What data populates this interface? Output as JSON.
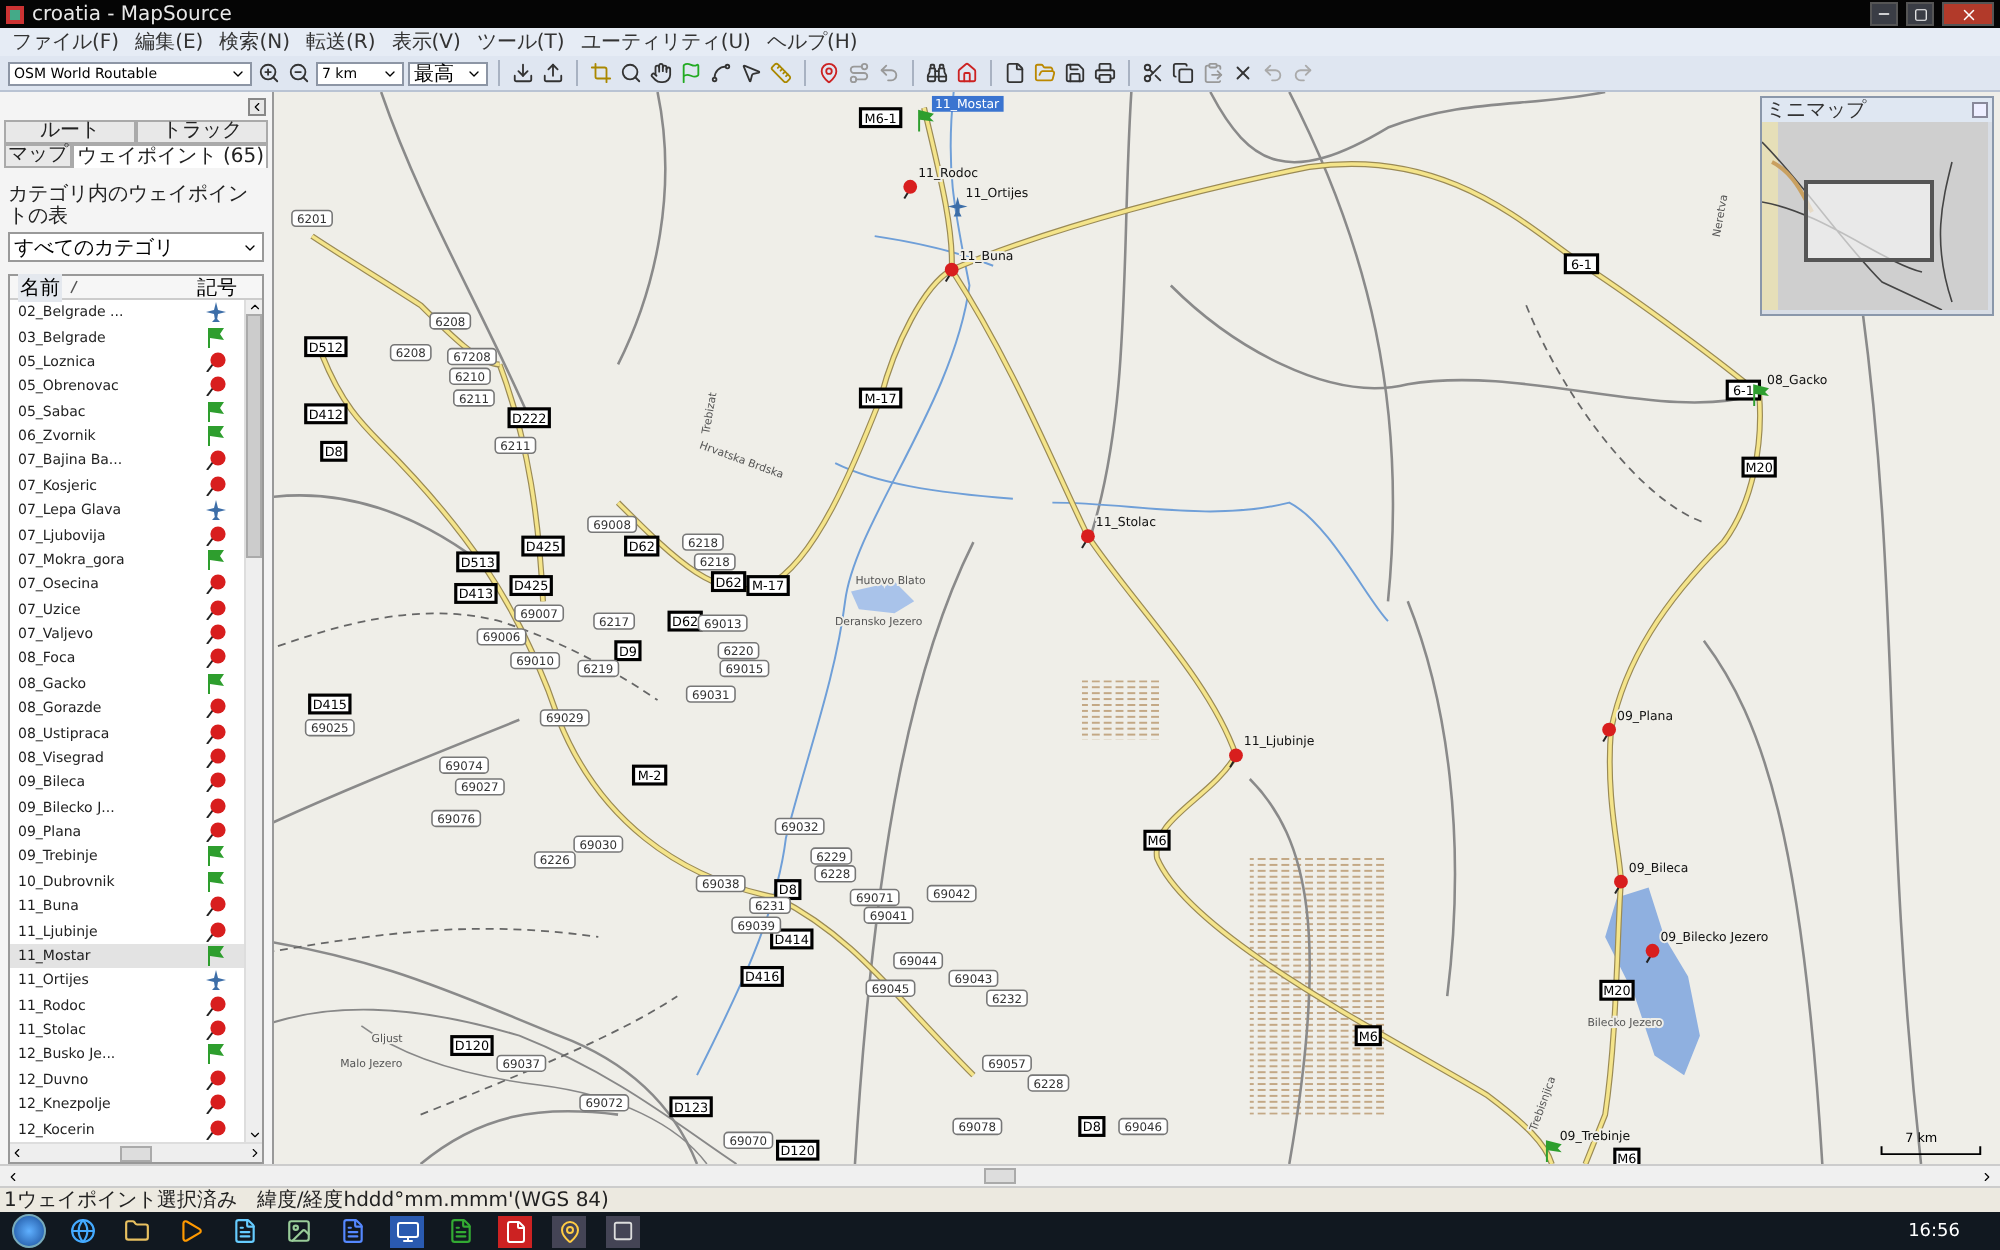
{
  "window": {
    "title": "croatia - MapSource"
  },
  "menu": [
    "ファイル(F)",
    "編集(E)",
    "検索(N)",
    "転送(R)",
    "表示(V)",
    "ツール(T)",
    "ユーティリティ(U)",
    "ヘルプ(H)"
  ],
  "toolbar": {
    "map_product": "OSM World Routable",
    "zoom_scale": "7 km",
    "detail": "最高"
  },
  "sidebar": {
    "tabs_top": [
      {
        "label": "ルート",
        "selected": false
      },
      {
        "label": "トラック",
        "selected": false
      }
    ],
    "tabs_bottom": [
      {
        "label": "マップ",
        "selected": false
      },
      {
        "label": "ウェイポイント (65)",
        "selected": true
      }
    ],
    "category_label": "カテゴリ内のウェイポイントの表",
    "category": "すべてのカテゴリ",
    "columns": [
      {
        "label": "名前",
        "sorted": true
      },
      {
        "label": "記号",
        "sorted": false
      }
    ],
    "waypoints": [
      {
        "name": "02_Belgrade ...",
        "kind": "plane",
        "selected": false
      },
      {
        "name": "03_Belgrade",
        "kind": "flag",
        "selected": false
      },
      {
        "name": "05_Loznica",
        "kind": "pin",
        "selected": false
      },
      {
        "name": "05_Obrenovac",
        "kind": "pin",
        "selected": false
      },
      {
        "name": "05_Sabac",
        "kind": "flag",
        "selected": false
      },
      {
        "name": "06_Zvornik",
        "kind": "flag",
        "selected": false
      },
      {
        "name": "07_Bajina Ba...",
        "kind": "pin",
        "selected": false
      },
      {
        "name": "07_Kosjeric",
        "kind": "pin",
        "selected": false
      },
      {
        "name": "07_Lepa Glava",
        "kind": "plane",
        "selected": false
      },
      {
        "name": "07_Ljubovija",
        "kind": "pin",
        "selected": false
      },
      {
        "name": "07_Mokra_gora",
        "kind": "flag",
        "selected": false
      },
      {
        "name": "07_Osecina",
        "kind": "pin",
        "selected": false
      },
      {
        "name": "07_Uzice",
        "kind": "pin",
        "selected": false
      },
      {
        "name": "07_Valjevo",
        "kind": "pin",
        "selected": false
      },
      {
        "name": "08_Foca",
        "kind": "pin",
        "selected": false
      },
      {
        "name": "08_Gacko",
        "kind": "flag",
        "selected": false
      },
      {
        "name": "08_Gorazde",
        "kind": "pin",
        "selected": false
      },
      {
        "name": "08_Ustipraca",
        "kind": "pin",
        "selected": false
      },
      {
        "name": "08_Visegrad",
        "kind": "pin",
        "selected": false
      },
      {
        "name": "09_Bileca",
        "kind": "pin",
        "selected": false
      },
      {
        "name": "09_Bilecko J...",
        "kind": "pin",
        "selected": false
      },
      {
        "name": "09_Plana",
        "kind": "pin",
        "selected": false
      },
      {
        "name": "09_Trebinje",
        "kind": "flag",
        "selected": false
      },
      {
        "name": "10_Dubrovnik",
        "kind": "flag",
        "selected": false
      },
      {
        "name": "11_Buna",
        "kind": "pin",
        "selected": false
      },
      {
        "name": "11_Ljubinje",
        "kind": "pin",
        "selected": false
      },
      {
        "name": "11_Mostar",
        "kind": "flag",
        "selected": true
      },
      {
        "name": "11_Ortijes",
        "kind": "plane",
        "selected": false
      },
      {
        "name": "11_Rodoc",
        "kind": "pin",
        "selected": false
      },
      {
        "name": "11_Stolac",
        "kind": "pin",
        "selected": false
      },
      {
        "name": "12_Busko Je...",
        "kind": "flag",
        "selected": false
      },
      {
        "name": "12_Duvno",
        "kind": "pin",
        "selected": false
      },
      {
        "name": "12_Knezpolje",
        "kind": "pin",
        "selected": false
      },
      {
        "name": "12_Kocerin",
        "kind": "pin",
        "selected": false
      }
    ]
  },
  "map": {
    "waypoints": [
      {
        "name": "11_Mostar",
        "kind": "flag",
        "selected": true
      },
      {
        "name": "11_Rodoc",
        "kind": "pin",
        "selected": false
      },
      {
        "name": "11_Ortijes",
        "kind": "plane",
        "selected": false
      },
      {
        "name": "11_Buna",
        "kind": "pin",
        "selected": false
      },
      {
        "name": "11_Stolac",
        "kind": "pin",
        "selected": false
      },
      {
        "name": "11_Ljubinje",
        "kind": "pin",
        "selected": false
      },
      {
        "name": "09_Plana",
        "kind": "pin",
        "selected": false
      },
      {
        "name": "09_Bileca",
        "kind": "pin",
        "selected": false
      },
      {
        "name": "09_Bilecko Jezero",
        "kind": "pin",
        "selected": false
      },
      {
        "name": "08_Gacko",
        "kind": "flag",
        "selected": false
      },
      {
        "name": "09_Trebinje",
        "kind": "flag",
        "selected": false
      }
    ],
    "road_labels": [
      {
        "text": "M6-1",
        "kind": "highway"
      },
      {
        "text": "6-1",
        "kind": "highway"
      },
      {
        "text": "6-1",
        "kind": "highway"
      },
      {
        "text": "M-17",
        "kind": "highway"
      },
      {
        "text": "M-17",
        "kind": "highway"
      },
      {
        "text": "D512",
        "kind": "highway"
      },
      {
        "text": "D412",
        "kind": "highway"
      },
      {
        "text": "D8",
        "kind": "highway"
      },
      {
        "text": "D222",
        "kind": "highway"
      },
      {
        "text": "D425",
        "kind": "highway"
      },
      {
        "text": "D513",
        "kind": "highway"
      },
      {
        "text": "D413",
        "kind": "highway"
      },
      {
        "text": "D425",
        "kind": "highway"
      },
      {
        "text": "D62",
        "kind": "highway"
      },
      {
        "text": "D62",
        "kind": "highway"
      },
      {
        "text": "D9",
        "kind": "highway"
      },
      {
        "text": "D62",
        "kind": "highway"
      },
      {
        "text": "D415",
        "kind": "highway"
      },
      {
        "text": "M-2",
        "kind": "highway"
      },
      {
        "text": "M6",
        "kind": "highway"
      },
      {
        "text": "M20",
        "kind": "highway"
      },
      {
        "text": "M20",
        "kind": "highway"
      },
      {
        "text": "M6",
        "kind": "highway"
      },
      {
        "text": "D8",
        "kind": "highway"
      },
      {
        "text": "D414",
        "kind": "highway"
      },
      {
        "text": "D416",
        "kind": "highway"
      },
      {
        "text": "D120",
        "kind": "highway"
      },
      {
        "text": "D123",
        "kind": "highway"
      },
      {
        "text": "D120",
        "kind": "highway"
      },
      {
        "text": "D8",
        "kind": "highway"
      },
      {
        "text": "M6",
        "kind": "highway"
      },
      {
        "text": "6201",
        "kind": "local"
      },
      {
        "text": "6208",
        "kind": "local"
      },
      {
        "text": "6208",
        "kind": "local"
      },
      {
        "text": "67208",
        "kind": "local"
      },
      {
        "text": "6210",
        "kind": "local"
      },
      {
        "text": "6211",
        "kind": "local"
      },
      {
        "text": "6211",
        "kind": "local"
      },
      {
        "text": "69008",
        "kind": "local"
      },
      {
        "text": "6218",
        "kind": "local"
      },
      {
        "text": "6218",
        "kind": "local"
      },
      {
        "text": "6217",
        "kind": "local"
      },
      {
        "text": "69013",
        "kind": "local"
      },
      {
        "text": "69007",
        "kind": "local"
      },
      {
        "text": "69010",
        "kind": "local"
      },
      {
        "text": "69006",
        "kind": "local"
      },
      {
        "text": "6219",
        "kind": "local"
      },
      {
        "text": "6220",
        "kind": "local"
      },
      {
        "text": "69015",
        "kind": "local"
      },
      {
        "text": "69031",
        "kind": "local"
      },
      {
        "text": "69029",
        "kind": "local"
      },
      {
        "text": "69025",
        "kind": "local"
      },
      {
        "text": "69074",
        "kind": "local"
      },
      {
        "text": "69027",
        "kind": "local"
      },
      {
        "text": "69076",
        "kind": "local"
      },
      {
        "text": "69030",
        "kind": "local"
      },
      {
        "text": "6226",
        "kind": "local"
      },
      {
        "text": "69032",
        "kind": "local"
      },
      {
        "text": "69038",
        "kind": "local"
      },
      {
        "text": "6229",
        "kind": "local"
      },
      {
        "text": "6228",
        "kind": "local"
      },
      {
        "text": "6231",
        "kind": "local"
      },
      {
        "text": "69039",
        "kind": "local"
      },
      {
        "text": "69071",
        "kind": "local"
      },
      {
        "text": "69041",
        "kind": "local"
      },
      {
        "text": "69042",
        "kind": "local"
      },
      {
        "text": "69044",
        "kind": "local"
      },
      {
        "text": "69043",
        "kind": "local"
      },
      {
        "text": "69045",
        "kind": "local"
      },
      {
        "text": "6232",
        "kind": "local"
      },
      {
        "text": "69057",
        "kind": "local"
      },
      {
        "text": "6228",
        "kind": "local"
      },
      {
        "text": "69037",
        "kind": "local"
      },
      {
        "text": "69072",
        "kind": "local"
      },
      {
        "text": "69070",
        "kind": "local"
      },
      {
        "text": "69078",
        "kind": "local"
      },
      {
        "text": "69046",
        "kind": "local"
      }
    ],
    "place_labels": [
      "Trebizat",
      "Hutovo Blato",
      "Deransko Jezero",
      "Hrvatska Brdska",
      "Neretva",
      "Bilecko Jezero",
      "Gljust",
      "Malo Jezero",
      "Trebisnjica"
    ],
    "scale": "7 km"
  },
  "minimap": {
    "title": "ミニマップ"
  },
  "status_bar": [
    "1ウェイポイント選択済み",
    "緯度/経度hddd°mm.mmm'(WGS 84)"
  ],
  "taskbar": {
    "time": "16:56"
  }
}
